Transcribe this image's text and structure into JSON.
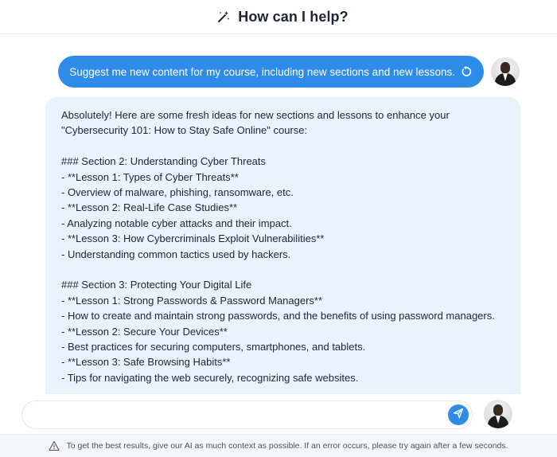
{
  "header": {
    "title": "How can I help?",
    "icon": "magic-wand-icon"
  },
  "conversation": {
    "user_message": {
      "text": "Suggest me new content for my course, including new sections and new lessons.",
      "action_icon": "retry-icon"
    },
    "assistant_message": {
      "lines": [
        "Absolutely! Here are some fresh ideas for new sections and lessons to enhance your \"Cybersecurity 101: How to Stay Safe Online\" course:",
        "",
        "### Section 2: Understanding Cyber Threats",
        "- **Lesson 1: Types of Cyber Threats**",
        "- Overview of malware, phishing, ransomware, etc.",
        "- **Lesson 2: Real-Life Case Studies**",
        "- Analyzing notable cyber attacks and their impact.",
        "- **Lesson 3: How Cybercriminals Exploit Vulnerabilities**",
        "- Understanding common tactics used by hackers.",
        "",
        "### Section 3: Protecting Your Digital Life",
        "- **Lesson 1: Strong Passwords & Password Managers**",
        "- How to create and maintain strong passwords, and the benefits of using password managers.",
        "- **Lesson 2: Secure Your Devices**",
        "- Best practices for securing computers, smartphones, and tablets.",
        "- **Lesson 3: Safe Browsing Habits**",
        "- Tips for navigating the web securely, recognizing safe websites."
      ]
    }
  },
  "composer": {
    "value": "",
    "placeholder": "",
    "send_icon": "send-icon"
  },
  "footer": {
    "notice": "To get the best results, give our AI as much context as possible. If an error occurs, please try again after a few seconds.",
    "icon": "warning-icon"
  },
  "colors": {
    "accent": "#2e8be8",
    "assistant_bubble": "#eaf2fd",
    "footer_bg": "#f6f7f9"
  }
}
